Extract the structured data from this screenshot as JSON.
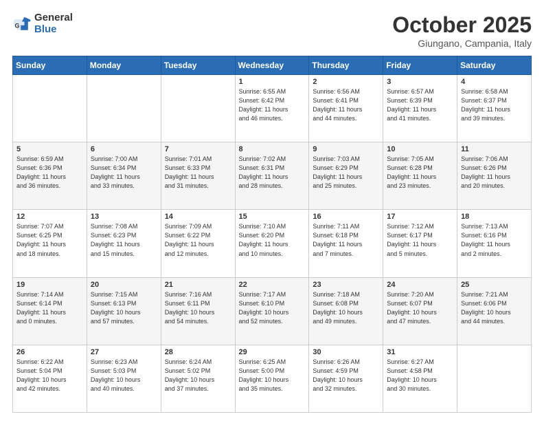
{
  "logo": {
    "general": "General",
    "blue": "Blue"
  },
  "title": "October 2025",
  "location": "Giungano, Campania, Italy",
  "headers": [
    "Sunday",
    "Monday",
    "Tuesday",
    "Wednesday",
    "Thursday",
    "Friday",
    "Saturday"
  ],
  "weeks": [
    [
      {
        "day": "",
        "info": ""
      },
      {
        "day": "",
        "info": ""
      },
      {
        "day": "",
        "info": ""
      },
      {
        "day": "1",
        "info": "Sunrise: 6:55 AM\nSunset: 6:42 PM\nDaylight: 11 hours\nand 46 minutes."
      },
      {
        "day": "2",
        "info": "Sunrise: 6:56 AM\nSunset: 6:41 PM\nDaylight: 11 hours\nand 44 minutes."
      },
      {
        "day": "3",
        "info": "Sunrise: 6:57 AM\nSunset: 6:39 PM\nDaylight: 11 hours\nand 41 minutes."
      },
      {
        "day": "4",
        "info": "Sunrise: 6:58 AM\nSunset: 6:37 PM\nDaylight: 11 hours\nand 39 minutes."
      }
    ],
    [
      {
        "day": "5",
        "info": "Sunrise: 6:59 AM\nSunset: 6:36 PM\nDaylight: 11 hours\nand 36 minutes."
      },
      {
        "day": "6",
        "info": "Sunrise: 7:00 AM\nSunset: 6:34 PM\nDaylight: 11 hours\nand 33 minutes."
      },
      {
        "day": "7",
        "info": "Sunrise: 7:01 AM\nSunset: 6:33 PM\nDaylight: 11 hours\nand 31 minutes."
      },
      {
        "day": "8",
        "info": "Sunrise: 7:02 AM\nSunset: 6:31 PM\nDaylight: 11 hours\nand 28 minutes."
      },
      {
        "day": "9",
        "info": "Sunrise: 7:03 AM\nSunset: 6:29 PM\nDaylight: 11 hours\nand 25 minutes."
      },
      {
        "day": "10",
        "info": "Sunrise: 7:05 AM\nSunset: 6:28 PM\nDaylight: 11 hours\nand 23 minutes."
      },
      {
        "day": "11",
        "info": "Sunrise: 7:06 AM\nSunset: 6:26 PM\nDaylight: 11 hours\nand 20 minutes."
      }
    ],
    [
      {
        "day": "12",
        "info": "Sunrise: 7:07 AM\nSunset: 6:25 PM\nDaylight: 11 hours\nand 18 minutes."
      },
      {
        "day": "13",
        "info": "Sunrise: 7:08 AM\nSunset: 6:23 PM\nDaylight: 11 hours\nand 15 minutes."
      },
      {
        "day": "14",
        "info": "Sunrise: 7:09 AM\nSunset: 6:22 PM\nDaylight: 11 hours\nand 12 minutes."
      },
      {
        "day": "15",
        "info": "Sunrise: 7:10 AM\nSunset: 6:20 PM\nDaylight: 11 hours\nand 10 minutes."
      },
      {
        "day": "16",
        "info": "Sunrise: 7:11 AM\nSunset: 6:18 PM\nDaylight: 11 hours\nand 7 minutes."
      },
      {
        "day": "17",
        "info": "Sunrise: 7:12 AM\nSunset: 6:17 PM\nDaylight: 11 hours\nand 5 minutes."
      },
      {
        "day": "18",
        "info": "Sunrise: 7:13 AM\nSunset: 6:16 PM\nDaylight: 11 hours\nand 2 minutes."
      }
    ],
    [
      {
        "day": "19",
        "info": "Sunrise: 7:14 AM\nSunset: 6:14 PM\nDaylight: 11 hours\nand 0 minutes."
      },
      {
        "day": "20",
        "info": "Sunrise: 7:15 AM\nSunset: 6:13 PM\nDaylight: 10 hours\nand 57 minutes."
      },
      {
        "day": "21",
        "info": "Sunrise: 7:16 AM\nSunset: 6:11 PM\nDaylight: 10 hours\nand 54 minutes."
      },
      {
        "day": "22",
        "info": "Sunrise: 7:17 AM\nSunset: 6:10 PM\nDaylight: 10 hours\nand 52 minutes."
      },
      {
        "day": "23",
        "info": "Sunrise: 7:18 AM\nSunset: 6:08 PM\nDaylight: 10 hours\nand 49 minutes."
      },
      {
        "day": "24",
        "info": "Sunrise: 7:20 AM\nSunset: 6:07 PM\nDaylight: 10 hours\nand 47 minutes."
      },
      {
        "day": "25",
        "info": "Sunrise: 7:21 AM\nSunset: 6:06 PM\nDaylight: 10 hours\nand 44 minutes."
      }
    ],
    [
      {
        "day": "26",
        "info": "Sunrise: 6:22 AM\nSunset: 5:04 PM\nDaylight: 10 hours\nand 42 minutes."
      },
      {
        "day": "27",
        "info": "Sunrise: 6:23 AM\nSunset: 5:03 PM\nDaylight: 10 hours\nand 40 minutes."
      },
      {
        "day": "28",
        "info": "Sunrise: 6:24 AM\nSunset: 5:02 PM\nDaylight: 10 hours\nand 37 minutes."
      },
      {
        "day": "29",
        "info": "Sunrise: 6:25 AM\nSunset: 5:00 PM\nDaylight: 10 hours\nand 35 minutes."
      },
      {
        "day": "30",
        "info": "Sunrise: 6:26 AM\nSunset: 4:59 PM\nDaylight: 10 hours\nand 32 minutes."
      },
      {
        "day": "31",
        "info": "Sunrise: 6:27 AM\nSunset: 4:58 PM\nDaylight: 10 hours\nand 30 minutes."
      },
      {
        "day": "",
        "info": ""
      }
    ]
  ]
}
